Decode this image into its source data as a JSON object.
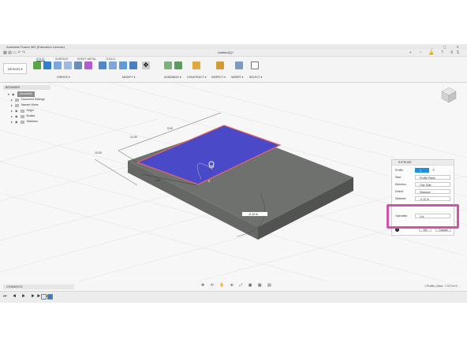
{
  "window": {
    "title": "Autodesk Fusion 360 (Education License)",
    "controls": "_ ▢ ✕"
  },
  "document": {
    "tab_title": "Untitled(1)*",
    "right_icons": "+ ◔ 🔔 ? KS"
  },
  "ribbon": {
    "workspace": "DESIGN ▾",
    "subtabs": [
      "SOLID",
      "SURFACE",
      "SHEET METAL",
      "TOOLS"
    ],
    "groups": [
      "CREATE ▾",
      "MODIFY ▾",
      "ASSEMBLE ▾",
      "CONSTRUCT ▾",
      "INSPECT ▾",
      "INSERT ▾",
      "SELECT ▾"
    ]
  },
  "browser": {
    "title": "BROWSER",
    "items": [
      {
        "label": "(Unsaved)",
        "root": true
      },
      {
        "label": "Document Settings"
      },
      {
        "label": "Named Views"
      },
      {
        "label": "Origin"
      },
      {
        "label": "Bodies"
      },
      {
        "label": "Sketches"
      }
    ]
  },
  "viewport": {
    "dims": {
      "top": "3.00",
      "left1": "12.00",
      "left2": "10.00",
      "height": "1.00",
      "right": "8"
    },
    "distance_input": "-0.12 in",
    "viewcube": "FRONT"
  },
  "extrude": {
    "title": "EXTRUDE",
    "rows": [
      {
        "label": "Profile",
        "value": "1 selected",
        "selected": true
      },
      {
        "label": "Start",
        "value": "Profile Plane"
      },
      {
        "label": "Direction",
        "value": "One Side"
      },
      {
        "label": "Extent",
        "value": "Distance"
      },
      {
        "label": "Distance",
        "value": "-0.12 in"
      }
    ],
    "operation": {
      "label": "Operation",
      "value": "Cut"
    },
    "ok": "OK",
    "cancel": "Cancel",
    "info_icon": "i"
  },
  "bottom": {
    "comments": "COMMENTS",
    "nav_tools": "✥ ⟲ ✋ ⊕ ⤢ ▣ ▦ ▤",
    "status": "1 Profile | Area : 7.972 in^2"
  },
  "timeline": {
    "controls": "⏮ ◀ ▶ ▶▶ ⏭"
  },
  "colors": {
    "accent": "#1f8fdb",
    "highlight": "#d254aa",
    "sketch_fill": "#4a4ac8",
    "body": "#6f716d"
  }
}
